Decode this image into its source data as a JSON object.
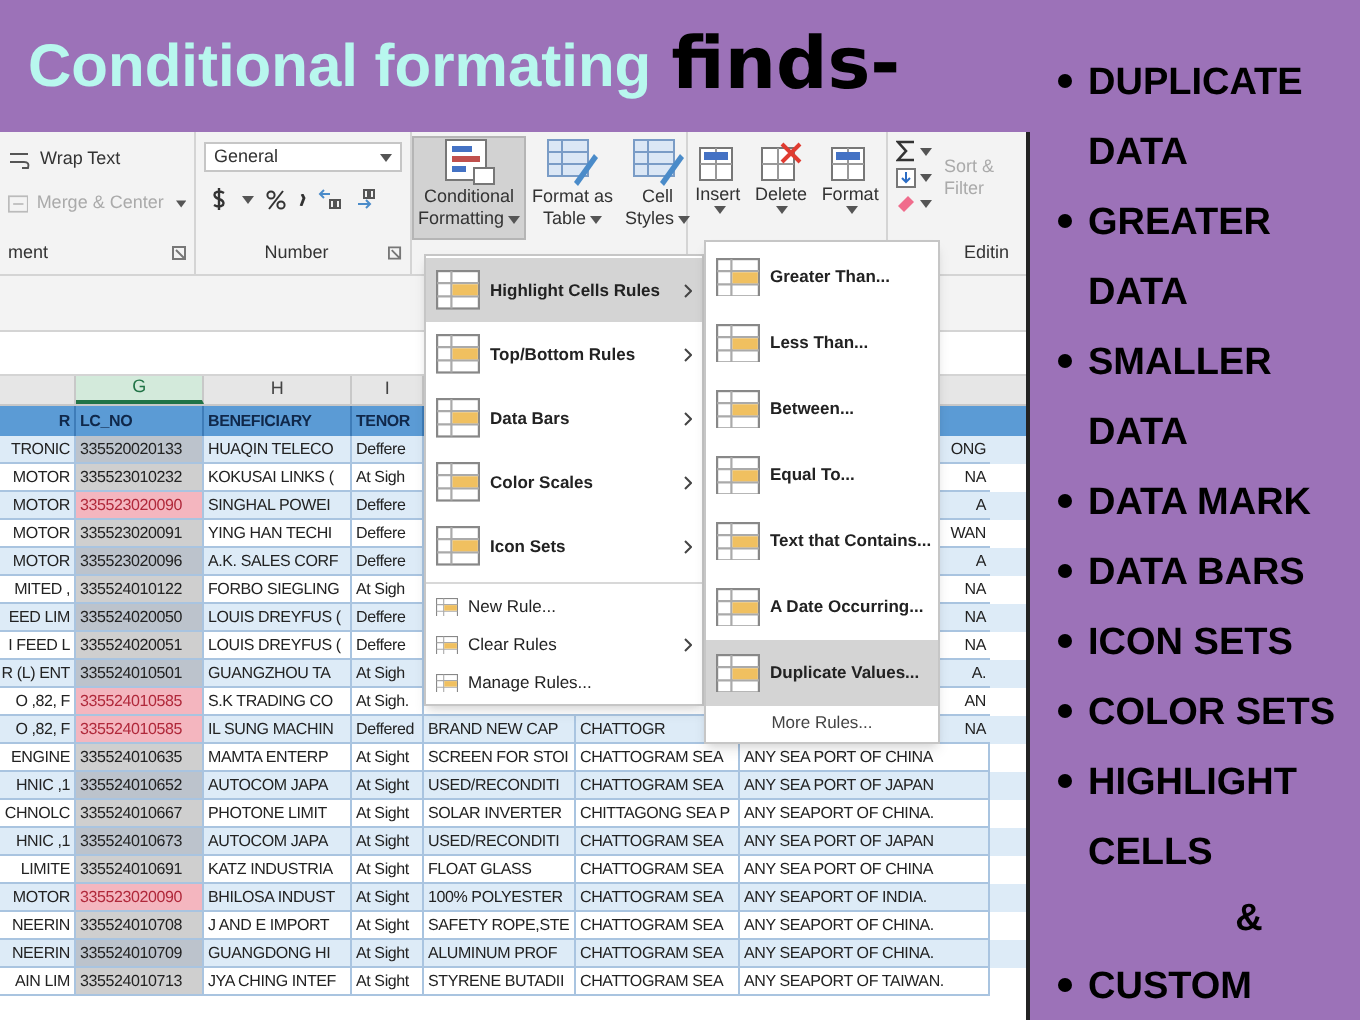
{
  "title": {
    "main": "Conditional formating",
    "accent": "finds-"
  },
  "ribbon": {
    "alignment": {
      "wrap_text": "Wrap Text",
      "merge_center": {
        "label": "Merge & Center",
        "disabled": true
      },
      "group_label": "ment"
    },
    "number": {
      "format": "General",
      "group_label": "Number"
    },
    "style_buttons": [
      {
        "lines": [
          "Conditional",
          "Formatting"
        ],
        "selected": true
      },
      {
        "lines": [
          "Format as",
          "Table"
        ],
        "selected": false
      },
      {
        "lines": [
          "Cell",
          "Styles"
        ],
        "selected": false
      }
    ],
    "cell_buttons": [
      "Insert",
      "Delete",
      "Format"
    ],
    "editing": {
      "sort_filter": [
        "Sort &",
        "Filter"
      ],
      "group_label": "Editin"
    }
  },
  "sheet": {
    "column_headers": [
      {
        "letter": "G",
        "selected": true
      },
      {
        "letter": "H",
        "selected": false
      },
      {
        "letter": "I",
        "selected": false
      }
    ],
    "header_row": [
      "R",
      "LC_NO",
      "BENEFICIARY",
      "TENOR"
    ],
    "rows": [
      {
        "cells": [
          "TRONIC",
          "335520020133",
          "HUAQIN TELECO",
          "Deffere"
        ],
        "tail": "ONG",
        "duplicate": false
      },
      {
        "cells": [
          "MOTOR",
          "335523010232",
          "KOKUSAI LINKS (",
          "At Sigh"
        ],
        "tail": "NA",
        "duplicate": false
      },
      {
        "cells": [
          "MOTOR",
          "335523020090",
          "SINGHAL POWEI",
          "Deffere"
        ],
        "tail": "A",
        "duplicate": true
      },
      {
        "cells": [
          "MOTOR",
          "335523020091",
          "YING HAN TECHI",
          "Deffere"
        ],
        "tail": "WAN",
        "duplicate": false
      },
      {
        "cells": [
          "MOTOR",
          "335523020096",
          "A.K. SALES CORF",
          "Deffere"
        ],
        "tail": "A",
        "duplicate": false
      },
      {
        "cells": [
          "MITED ,",
          "335524010122",
          "FORBO SIEGLING",
          "At Sigh"
        ],
        "tail": "NA",
        "duplicate": false
      },
      {
        "cells": [
          "EED LIM",
          "335524020050",
          "LOUIS DREYFUS (",
          "Deffere"
        ],
        "tail": "NA",
        "duplicate": false
      },
      {
        "cells": [
          "I FEED L",
          "335524020051",
          "LOUIS DREYFUS (",
          "Deffere"
        ],
        "tail": "NA",
        "duplicate": false
      },
      {
        "cells": [
          "R (L) ENT",
          "335524010501",
          "GUANGZHOU TA",
          "At Sigh"
        ],
        "tail": "A.",
        "duplicate": false
      },
      {
        "cells": [
          "O ,82, F",
          "335524010585",
          "S.K TRADING CO",
          "At Sigh."
        ],
        "tail": "AN",
        "duplicate": true
      },
      {
        "cells": [
          "O ,82, F",
          "335524010585",
          "IL SUNG MACHIN",
          "Deffered",
          "BRAND NEW CAP",
          "CHATTOGR"
        ],
        "tail": "NA",
        "duplicate": true
      },
      {
        "cells": [
          "ENGINE",
          "335524010635",
          "MAMTA ENTERP",
          "At Sight",
          "SCREEN FOR STOI",
          "CHATTOGRAM SEA",
          "ANY SEA PORT OF CHINA"
        ],
        "duplicate": false
      },
      {
        "cells": [
          "HNIC ,1",
          "335524010652",
          "AUTOCOM JAPA",
          "At Sight",
          "USED/RECONDITI",
          "CHATTOGRAM SEA",
          "ANY SEA PORT OF JAPAN"
        ],
        "duplicate": false
      },
      {
        "cells": [
          "CHNOLC",
          "335524010667",
          "PHOTONE LIMIT",
          "At Sight",
          "SOLAR INVERTER",
          "CHITTAGONG SEA P",
          "ANY SEAPORT OF CHINA."
        ],
        "duplicate": false
      },
      {
        "cells": [
          "HNIC ,1",
          "335524010673",
          "AUTOCOM JAPA",
          "At Sight",
          "USED/RECONDITI",
          "CHATTOGRAM SEA",
          "ANY SEA PORT OF JAPAN"
        ],
        "duplicate": false
      },
      {
        "cells": [
          "LIMITE",
          "335524010691",
          "KATZ INDUSTRIA",
          "At Sight",
          "FLOAT GLASS",
          "CHATTOGRAM SEA",
          "ANY SEA PORT OF CHINA"
        ],
        "duplicate": false
      },
      {
        "cells": [
          "MOTOR",
          "335523020090",
          "BHILOSA INDUST",
          "At Sight",
          "100% POLYESTER",
          "CHATTOGRAM  SEA",
          "ANY SEAPORT OF INDIA."
        ],
        "duplicate": true
      },
      {
        "cells": [
          "NEERIN",
          "335524010708",
          "J AND E IMPORT",
          "At Sight",
          "SAFETY ROPE,STE",
          "CHATTOGRAM SEA",
          "ANY SEAPORT OF CHINA."
        ],
        "duplicate": false
      },
      {
        "cells": [
          "NEERIN",
          "335524010709",
          "GUANGDONG HI",
          "At Sight",
          "ALUMINUM PROF",
          "CHATTOGRAM SEA",
          "ANY SEAPORT OF CHINA."
        ],
        "duplicate": false
      },
      {
        "cells": [
          "AIN LIM",
          "335524010713",
          "JYA CHING INTEF",
          "At Sight",
          "STYRENE BUTADII",
          "CHATTOGRAM SEA",
          "ANY SEAPORT OF TAIWAN."
        ],
        "duplicate": false
      }
    ]
  },
  "menu": {
    "items": [
      {
        "label": "Highlight Cells Rules",
        "kind": "large",
        "submenu": true,
        "selected": true
      },
      {
        "label": "Top/Bottom Rules",
        "kind": "large",
        "submenu": true,
        "selected": false
      },
      {
        "label": "Data Bars",
        "kind": "large",
        "submenu": true,
        "selected": false
      },
      {
        "label": "Color Scales",
        "kind": "large",
        "submenu": true,
        "selected": false
      },
      {
        "label": "Icon Sets",
        "kind": "large",
        "submenu": true,
        "selected": false
      },
      {
        "label": "New Rule...",
        "kind": "small",
        "submenu": false,
        "selected": false
      },
      {
        "label": "Clear Rules",
        "kind": "small",
        "submenu": true,
        "selected": false
      },
      {
        "label": "Manage Rules...",
        "kind": "small",
        "submenu": false,
        "selected": false
      }
    ]
  },
  "submenu": {
    "items": [
      {
        "label": "Greater Than...",
        "kind": "rule",
        "selected": false
      },
      {
        "label": "Less Than...",
        "kind": "rule",
        "selected": false
      },
      {
        "label": "Between...",
        "kind": "rule",
        "selected": false
      },
      {
        "label": "Equal To...",
        "kind": "rule",
        "selected": false
      },
      {
        "label": "Text that Contains...",
        "kind": "rule",
        "selected": false
      },
      {
        "label": "A Date Occurring...",
        "kind": "rule",
        "selected": false
      },
      {
        "label": "Duplicate Values...",
        "kind": "rule",
        "selected": true
      },
      {
        "label": "More Rules...",
        "kind": "link",
        "selected": false
      }
    ]
  },
  "features": [
    {
      "kind": "bullet",
      "text": "DUPLICATE DATA"
    },
    {
      "kind": "bullet",
      "text": "GREATER DATA"
    },
    {
      "kind": "bullet",
      "text": "SMALLER DATA"
    },
    {
      "kind": "bullet",
      "text": "DATA MARK"
    },
    {
      "kind": "bullet",
      "text": "DATA BARS"
    },
    {
      "kind": "bullet",
      "text": "ICON SETS"
    },
    {
      "kind": "bullet",
      "text": "COLOR SETS"
    },
    {
      "kind": "bullet",
      "text": "HIGHLIGHT CELLS"
    },
    {
      "kind": "joiner",
      "text": "&"
    },
    {
      "kind": "bullet",
      "text": "CUSTOM"
    }
  ]
}
